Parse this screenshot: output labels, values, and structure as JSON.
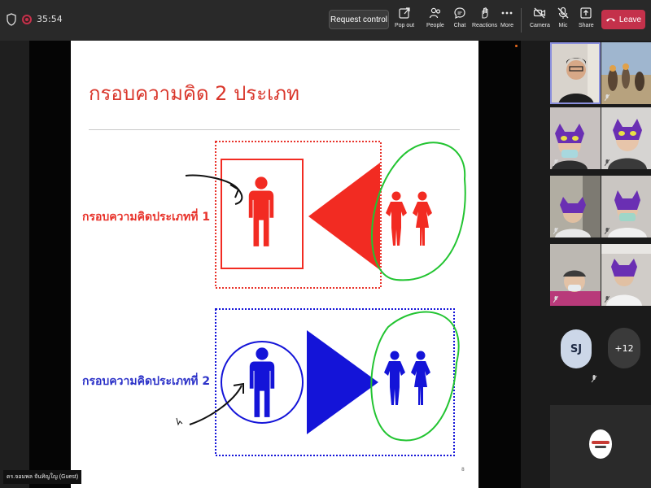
{
  "top_bar": {
    "timer": "35:54",
    "request_control": "Request control",
    "buttons": [
      {
        "label": "Pop out",
        "icon": "pop-out-icon"
      },
      {
        "label": "People",
        "icon": "people-icon"
      },
      {
        "label": "Chat",
        "icon": "chat-icon"
      },
      {
        "label": "Reactions",
        "icon": "reactions-icon"
      },
      {
        "label": "More",
        "icon": "more-icon"
      },
      {
        "label": "Camera",
        "icon": "camera-off-icon"
      },
      {
        "label": "Mic",
        "icon": "mic-off-icon"
      },
      {
        "label": "Share",
        "icon": "share-icon"
      }
    ],
    "leave": "Leave",
    "leave_color": "#c4314b"
  },
  "slide": {
    "title": "กรอบความคิด 2 ประเภท",
    "frame_1_label": "กรอบความคิดประเภทที่ 1",
    "frame_2_label": "กรอบความคิดประเภทที่ 2",
    "page_number": "8",
    "colors": {
      "red": "#f22b22",
      "blue": "#1414d8",
      "green": "#22c431"
    }
  },
  "presenter_name": "ดร.จอมพล จันทิญใญ (Guest)",
  "participants": {
    "initials": "SJ",
    "overflow_count": "+12"
  }
}
